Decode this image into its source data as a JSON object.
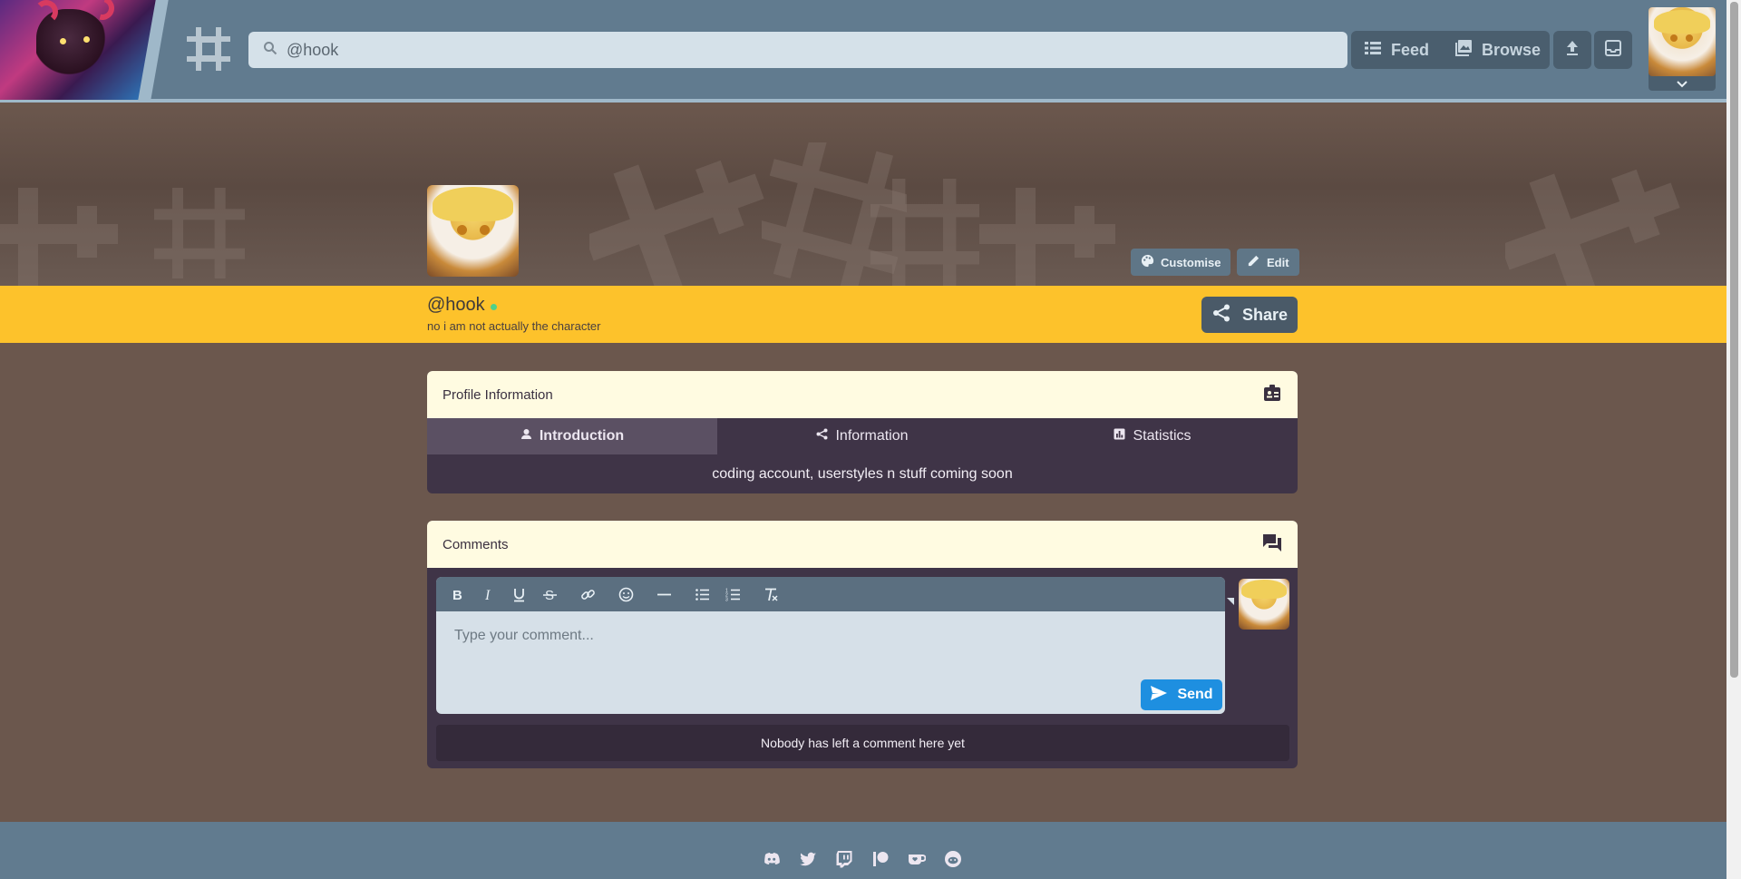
{
  "header": {
    "search_value": "@hook",
    "nav": [
      {
        "label": "Feed",
        "icon": "list-icon"
      },
      {
        "label": "Browse",
        "icon": "gallery-icon"
      }
    ],
    "icons": [
      "upload-icon",
      "inbox-icon",
      "chevron-down-icon"
    ]
  },
  "profile": {
    "handle": "@hook",
    "tagline": "no i am not actually the character",
    "customise_label": "Customise",
    "edit_label": "Edit",
    "share_label": "Share",
    "online": true
  },
  "profile_info": {
    "title": "Profile Information",
    "tabs": [
      {
        "label": "Introduction",
        "icon": "user-icon",
        "active": true
      },
      {
        "label": "Information",
        "icon": "share-icon",
        "active": false
      },
      {
        "label": "Statistics",
        "icon": "chart-icon",
        "active": false
      }
    ],
    "introduction": "coding account, userstyles n stuff coming soon"
  },
  "comments": {
    "title": "Comments",
    "placeholder": "Type your comment...",
    "send_label": "Send",
    "empty_text": "Nobody has left a comment here yet",
    "toolbar": [
      "bold-icon",
      "italic-icon",
      "underline-icon",
      "strikethrough-icon",
      "link-icon",
      "emoji-icon",
      "horizontal-rule-icon",
      "bullet-list-icon",
      "numbered-list-icon",
      "clear-format-icon"
    ]
  },
  "footer": {
    "socials": [
      "discord-icon",
      "twitter-icon",
      "twitch-icon",
      "patreon-icon",
      "kofi-icon",
      "reddit-icon"
    ]
  },
  "colors": {
    "topbar": "#617b8f",
    "accent_yellow": "#fdc22b",
    "background": "#6b574d",
    "panel_dark": "#3f3447",
    "send_blue": "#1e8fe0"
  }
}
